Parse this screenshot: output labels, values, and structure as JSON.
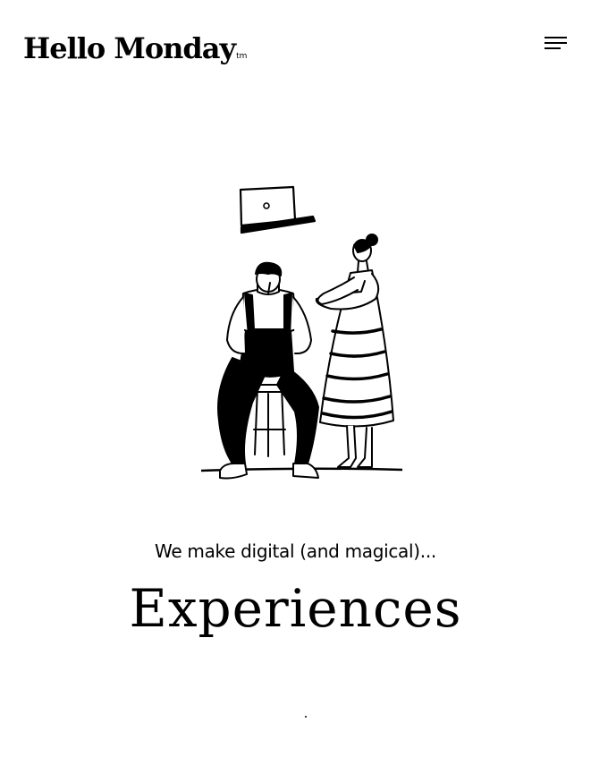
{
  "header": {
    "logo_text": "Hello Monday",
    "logo_tm": "tm"
  },
  "icons": {
    "menu": "hamburger-menu-icon"
  },
  "hero": {
    "tagline": "We make digital (and magical)...",
    "headline": "Experiences"
  },
  "colors": {
    "background": "#ffffff",
    "ink": "#000000"
  }
}
